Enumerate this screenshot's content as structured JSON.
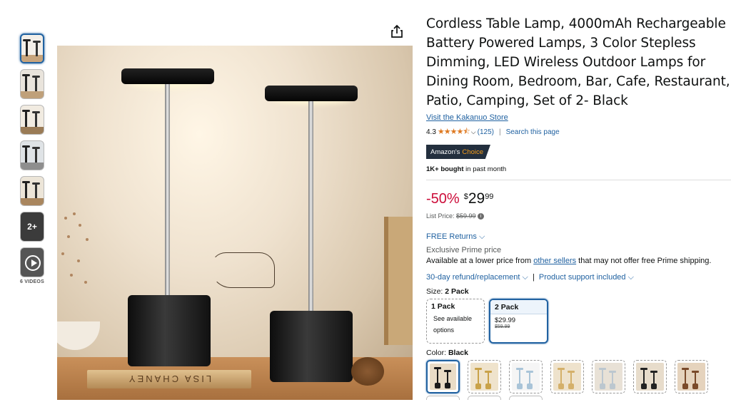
{
  "gallery": {
    "more_label": "2+",
    "videos_label": "6 VIDEOS"
  },
  "main_image": {
    "book_text": "LISA CHANEY"
  },
  "product": {
    "title": "Cordless Table Lamp, 4000mAh Rechargeable Battery Powered Lamps, 3 Color Stepless Dimming, LED Wireless Outdoor Lamps for Dining Room, Bedroom, Bar, Cafe, Restaurant, Patio, Camping, Set of 2- Black",
    "store_link": "Visit the Kakanuo Store",
    "rating_value": "4.3",
    "rating_stars": 4.3,
    "stars_glyphs": "★★★★⯪",
    "review_count": "(125)",
    "search_page": "Search this page",
    "badge_prefix": "Amazon's",
    "badge_choice": "Choice",
    "bought_bold": "1K+ bought",
    "bought_rest": " in past month"
  },
  "pricing": {
    "discount": "-50%",
    "currency": "$",
    "whole": "29",
    "fraction": "99",
    "list_price_label": "List Price: ",
    "list_price": "$59.99",
    "info_glyph": "i"
  },
  "delivery": {
    "free_returns": "FREE Returns",
    "exclusive": "Exclusive Prime price",
    "available_pre": "Available at a lower price from ",
    "other_sellers": "other sellers",
    "available_post": " that may not offer free Prime shipping.",
    "refund": "30-day refund/replacement",
    "separator": "|",
    "support": "Product support included"
  },
  "size": {
    "label": "Size: ",
    "selected": "2 Pack",
    "options": [
      {
        "name": "1 Pack",
        "line1": "See available",
        "line2": "options"
      },
      {
        "name": "2 Pack",
        "price": "$29.99",
        "old_price": "$59.99"
      }
    ]
  },
  "color": {
    "label": "Color: ",
    "selected": "Black",
    "swatch_colors": [
      "#1a1a1a",
      "#c9a24a",
      "#a9c4d8",
      "#d4b06a",
      "#bcc7cf",
      "#222222",
      "#7a4a2a"
    ],
    "swatch_bgs": [
      "#e9dcc6",
      "#efe3cc",
      "#f5f5f5",
      "#eee2cc",
      "#e8e1d6",
      "#e7dccb",
      "#e5d3bd"
    ]
  }
}
